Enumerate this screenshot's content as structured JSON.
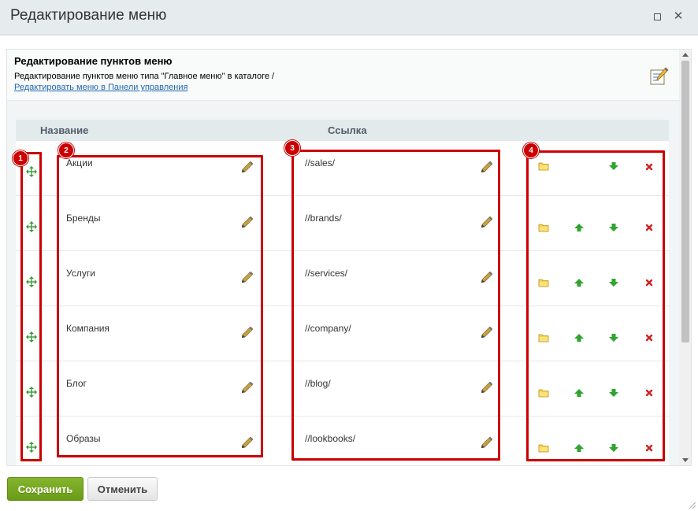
{
  "window": {
    "title": "Редактирование меню",
    "maximize_icon": "maximize-icon",
    "close_icon": "close-icon"
  },
  "header": {
    "title": "Редактирование пунктов меню",
    "description": "Редактирование пунктов меню типа \"Главное меню\" в каталоге /",
    "link": "Редактировать меню в Панели управления",
    "icon": "edit-document-icon"
  },
  "table": {
    "columns": {
      "name": "Название",
      "link": "Ссылка"
    },
    "rows": [
      {
        "name": "Акции",
        "url": "//sales/",
        "has_up": false
      },
      {
        "name": "Бренды",
        "url": "//brands/",
        "has_up": true
      },
      {
        "name": "Услуги",
        "url": "//services/",
        "has_up": true
      },
      {
        "name": "Компания",
        "url": "//company/",
        "has_up": true
      },
      {
        "name": "Блог",
        "url": "//blog/",
        "has_up": true
      },
      {
        "name": "Образы",
        "url": "//lookbooks/",
        "has_up": true
      }
    ]
  },
  "annotations": {
    "b1": "1",
    "b2": "2",
    "b3": "3",
    "b4": "4"
  },
  "footer": {
    "save": "Сохранить",
    "cancel": "Отменить"
  },
  "colors": {
    "accent_save": "#76a821",
    "annotation": "#cc0000",
    "link": "#2067b0"
  }
}
